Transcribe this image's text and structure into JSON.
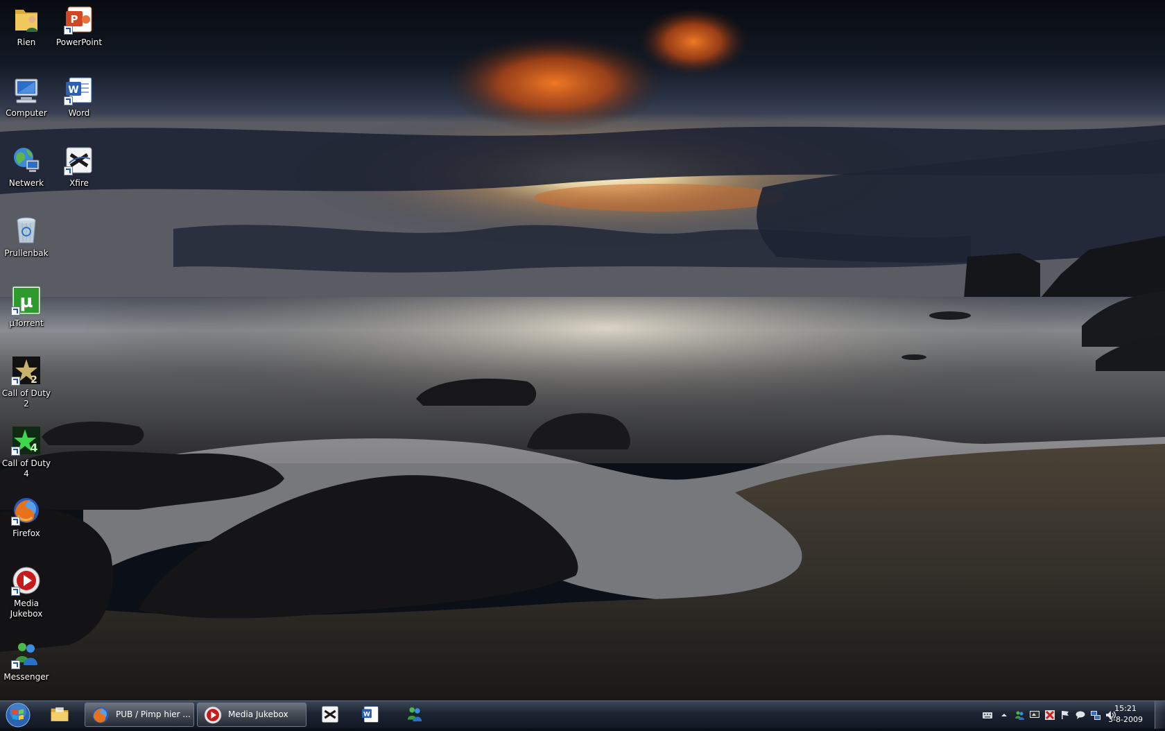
{
  "desktop": {
    "icons": [
      {
        "label": "Rien",
        "icon": "user-folder-icon"
      },
      {
        "label": "PowerPoint",
        "icon": "powerpoint-icon"
      },
      {
        "label": "Computer",
        "icon": "computer-icon"
      },
      {
        "label": "Word",
        "icon": "word-icon"
      },
      {
        "label": "Netwerk",
        "icon": "network-icon"
      },
      {
        "label": "Xfire",
        "icon": "xfire-icon"
      },
      {
        "label": "Prullenbak",
        "icon": "recycle-bin-icon"
      },
      {
        "label": "µTorrent",
        "icon": "utorrent-icon"
      },
      {
        "label": "Call of Duty 2",
        "icon": "call-of-duty-2-icon"
      },
      {
        "label": "Call of Duty 4",
        "icon": "call-of-duty-4-icon"
      },
      {
        "label": "Firefox",
        "icon": "firefox-icon"
      },
      {
        "label": "Media Jukebox",
        "icon": "media-jukebox-icon"
      },
      {
        "label": "Messenger",
        "icon": "messenger-icon"
      }
    ]
  },
  "taskbar": {
    "tasks": [
      {
        "label": "PUB / Pimp hier ...",
        "icon": "firefox-icon"
      },
      {
        "label": "Media Jukebox",
        "icon": "media-jukebox-icon"
      }
    ],
    "pinned": [
      "xfire-icon",
      "word-icon",
      "messenger-icon"
    ],
    "clock": {
      "time": "15:21",
      "date": "3-8-2009"
    }
  }
}
